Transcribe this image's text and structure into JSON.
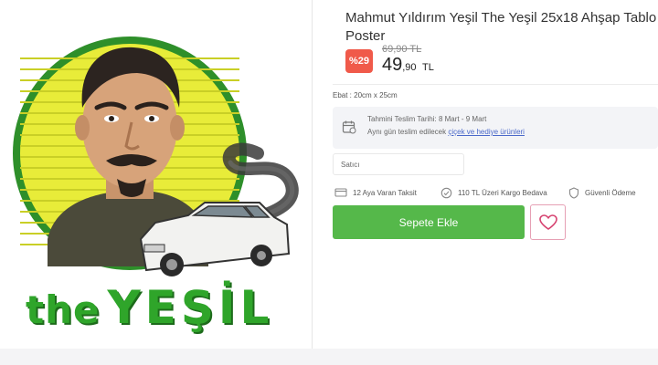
{
  "product": {
    "title": "Mahmut Yıldırım Yeşil The Yeşil 25x18 Ahşap Tablo Poster",
    "image_brand_prefix": "the",
    "image_brand_name": "YEŞİL",
    "discount_badge": "%29",
    "old_price": "69,90 TL",
    "price_integer": "49",
    "price_decimal": ",90",
    "price_currency": "TL",
    "size_label": "Ebat : 20cm x 25cm"
  },
  "delivery": {
    "icon": "calendar-delivery-icon",
    "estimate_text": "Tahmini Teslim Tarihi: 8 Mart - 9 Mart",
    "same_day_prefix": "Aynı gün teslim edilecek",
    "same_day_link": "çiçek ve hediye ürünleri"
  },
  "seller": {
    "label": "Satıcı"
  },
  "features": [
    {
      "icon": "credit-card-icon",
      "label": "12 Aya Varan Taksit"
    },
    {
      "icon": "check-circle-icon",
      "label": "110 TL Üzeri Kargo Bedava"
    },
    {
      "icon": "shield-icon",
      "label": "Güvenli Ödeme"
    }
  ],
  "actions": {
    "add_to_cart": "Sepete Ekle",
    "favorite_icon": "heart-icon"
  },
  "colors": {
    "accent_green": "#55b84a",
    "discount_red": "#f05a4a",
    "link_blue": "#4a68c9",
    "brand_green": "#2fa52a",
    "poster_yellow": "#e8ec39"
  }
}
